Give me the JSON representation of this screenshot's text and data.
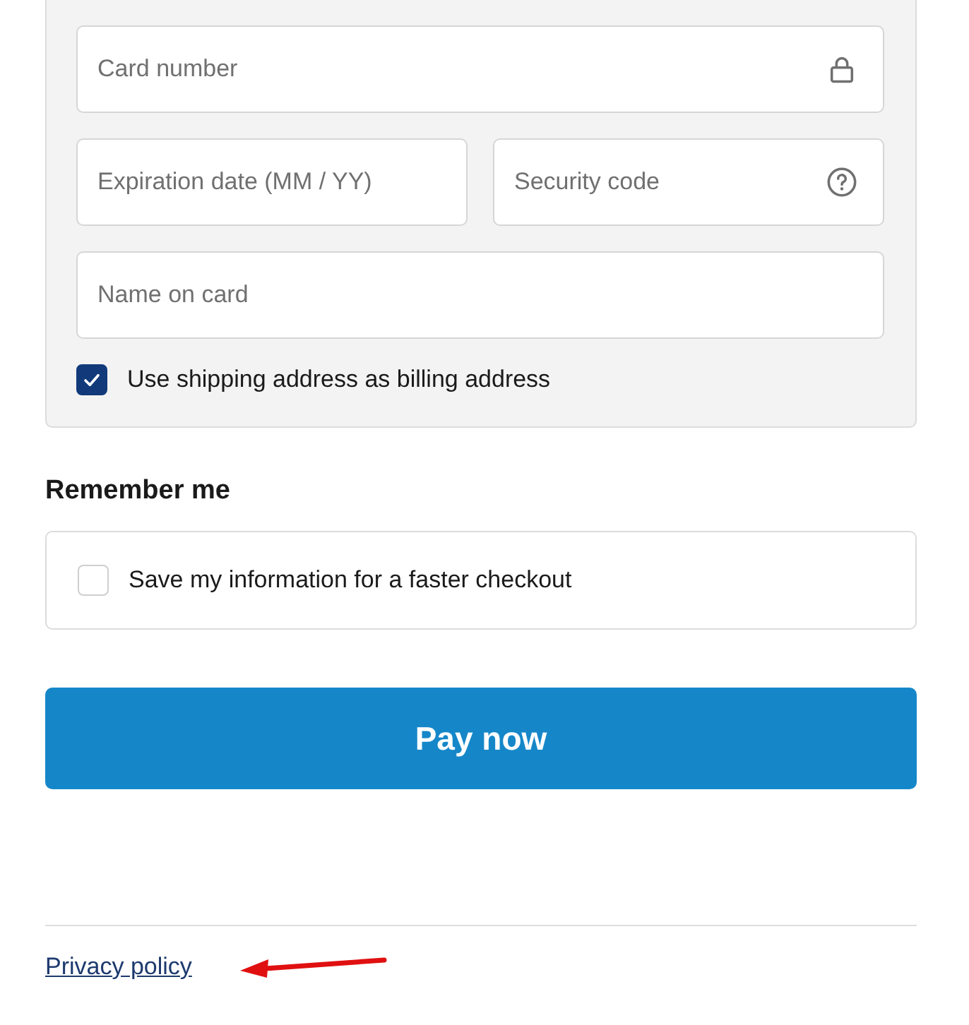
{
  "card_form": {
    "rows": [
      {
        "fields": [
          {
            "placeholder": "Card number",
            "kind": "secure"
          }
        ]
      },
      {
        "fields": [
          {
            "placeholder": "Expiration date (MM / YY)",
            "kind": "plain"
          },
          {
            "placeholder": "Security code",
            "kind": "help"
          }
        ]
      },
      {
        "fields": [
          {
            "placeholder": "Name on card",
            "kind": "plain"
          }
        ]
      }
    ],
    "billing_option": {
      "label": "Use shipping address as billing address",
      "checked": true
    }
  },
  "remember": {
    "heading": "Remember me",
    "option": {
      "label": "Save my information for a faster checkout",
      "checked": false
    }
  },
  "pay_button": "Pay now",
  "footer": {
    "link": "Privacy policy"
  }
}
